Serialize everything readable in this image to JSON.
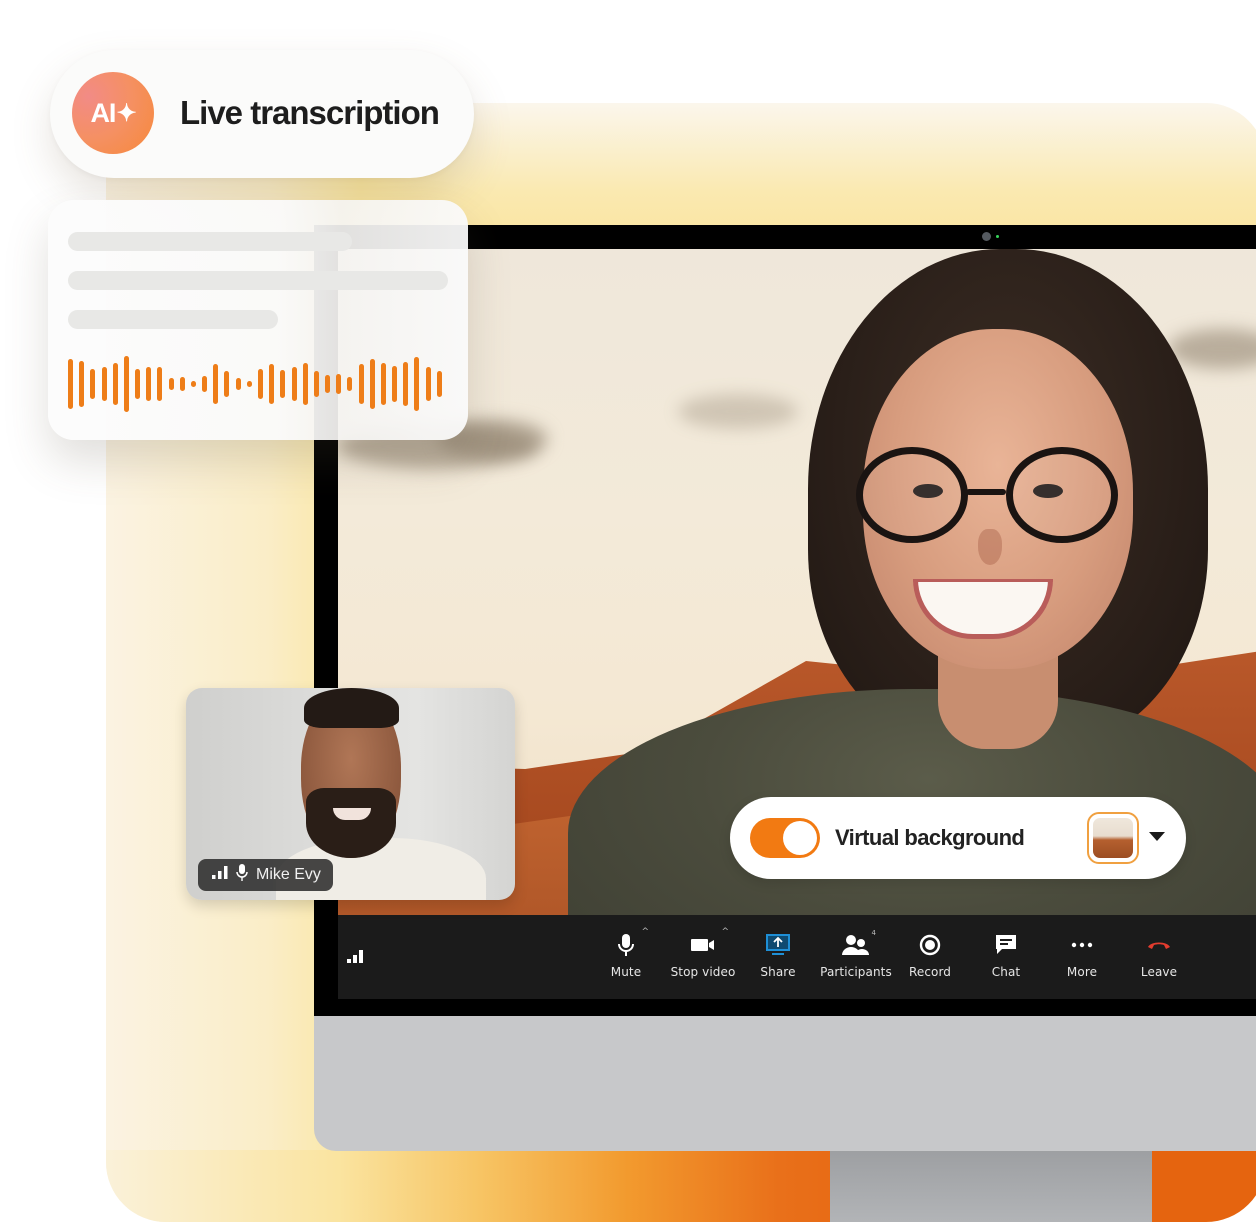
{
  "colors": {
    "accent_orange": "#f27a12",
    "waveform": "#ee7d18",
    "share_icon_blue": "#1e8fd6",
    "leave_icon_red": "#e33c2e",
    "toolbar_bg": "#1b1b1b"
  },
  "transcription_pill": {
    "badge_text": "AI",
    "badge_icon": "sparkle-icon",
    "title": "Live transcription"
  },
  "transcription_card": {
    "placeholder_lines": 3,
    "waveform_levels": [
      0.9,
      0.82,
      0.55,
      0.6,
      0.75,
      1.0,
      0.55,
      0.6,
      0.6,
      0.22,
      0.26,
      0.12,
      0.28,
      0.7,
      0.48,
      0.22,
      0.12,
      0.55,
      0.7,
      0.5,
      0.62,
      0.75,
      0.45,
      0.32,
      0.35,
      0.25,
      0.7,
      0.9,
      0.75,
      0.65,
      0.8,
      0.95,
      0.6,
      0.45
    ]
  },
  "self_view": {
    "participant_name": "Mike Evy",
    "signal_icon": "signal-bars-icon",
    "mic_icon": "microphone-icon"
  },
  "virtual_background": {
    "label": "Virtual background",
    "enabled": true,
    "dropdown_icon": "caret-down-icon"
  },
  "toolbar": {
    "signal_icon": "signal-bars-icon",
    "items": [
      {
        "id": "mute",
        "label": "Mute",
        "icon": "microphone-icon",
        "has_caret": true
      },
      {
        "id": "stop-video",
        "label": "Stop video",
        "icon": "video-camera-icon",
        "has_caret": true
      },
      {
        "id": "share",
        "label": "Share",
        "icon": "share-screen-icon"
      },
      {
        "id": "participants",
        "label": "Participants",
        "icon": "participants-icon",
        "count": "4"
      },
      {
        "id": "record",
        "label": "Record",
        "icon": "record-icon"
      },
      {
        "id": "chat",
        "label": "Chat",
        "icon": "chat-icon"
      },
      {
        "id": "more",
        "label": "More",
        "icon": "more-dots-icon"
      },
      {
        "id": "leave",
        "label": "Leave",
        "icon": "hang-up-icon"
      }
    ]
  }
}
